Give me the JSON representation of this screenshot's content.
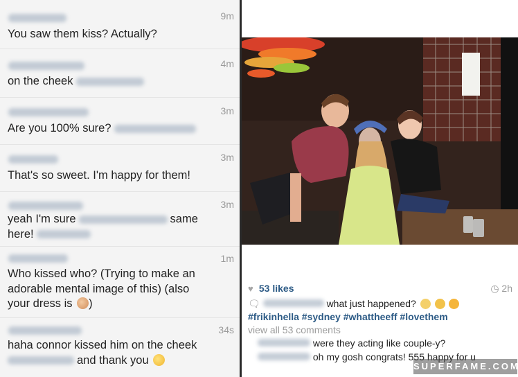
{
  "comments": [
    {
      "time": "9m",
      "text": "You saw them kiss? Actually?"
    },
    {
      "time": "4m",
      "text": "on the cheek"
    },
    {
      "time": "3m",
      "text": "Are you 100% sure?"
    },
    {
      "time": "3m",
      "text": "That's so sweet. I'm happy for them!"
    },
    {
      "time": "3m",
      "text_a": "yeah I'm sure",
      "text_b": "same",
      "text_c": "here!"
    },
    {
      "time": "1m",
      "text_a": "Who kissed who? (Trying to make an",
      "text_b": "adorable mental image of this) (also",
      "text_c": "your dress is"
    },
    {
      "time": "34s",
      "text_a": "haha connor kissed him on the cheek",
      "text_b": "and thank you"
    }
  ],
  "post": {
    "likes": "53 likes",
    "time": "2h",
    "caption": "what just happened?",
    "hashtags": "#frikinhella #sydney #whattheeff #lovethem",
    "view_all": "view all 53 comments",
    "comment1": "were they acting like couple-y?",
    "comment2": "oh my gosh congrats! 555 happy for u"
  },
  "watermark": "SUPERFAME.COM",
  "icons": {
    "heart": "heart-icon",
    "clock": "clock-icon",
    "comment": "comment-bubble-icon"
  },
  "colors": {
    "accent_blue": "#2d5b86",
    "comment_bg": "#f4f4f4",
    "timestamp_grey": "#9a9a9a"
  }
}
